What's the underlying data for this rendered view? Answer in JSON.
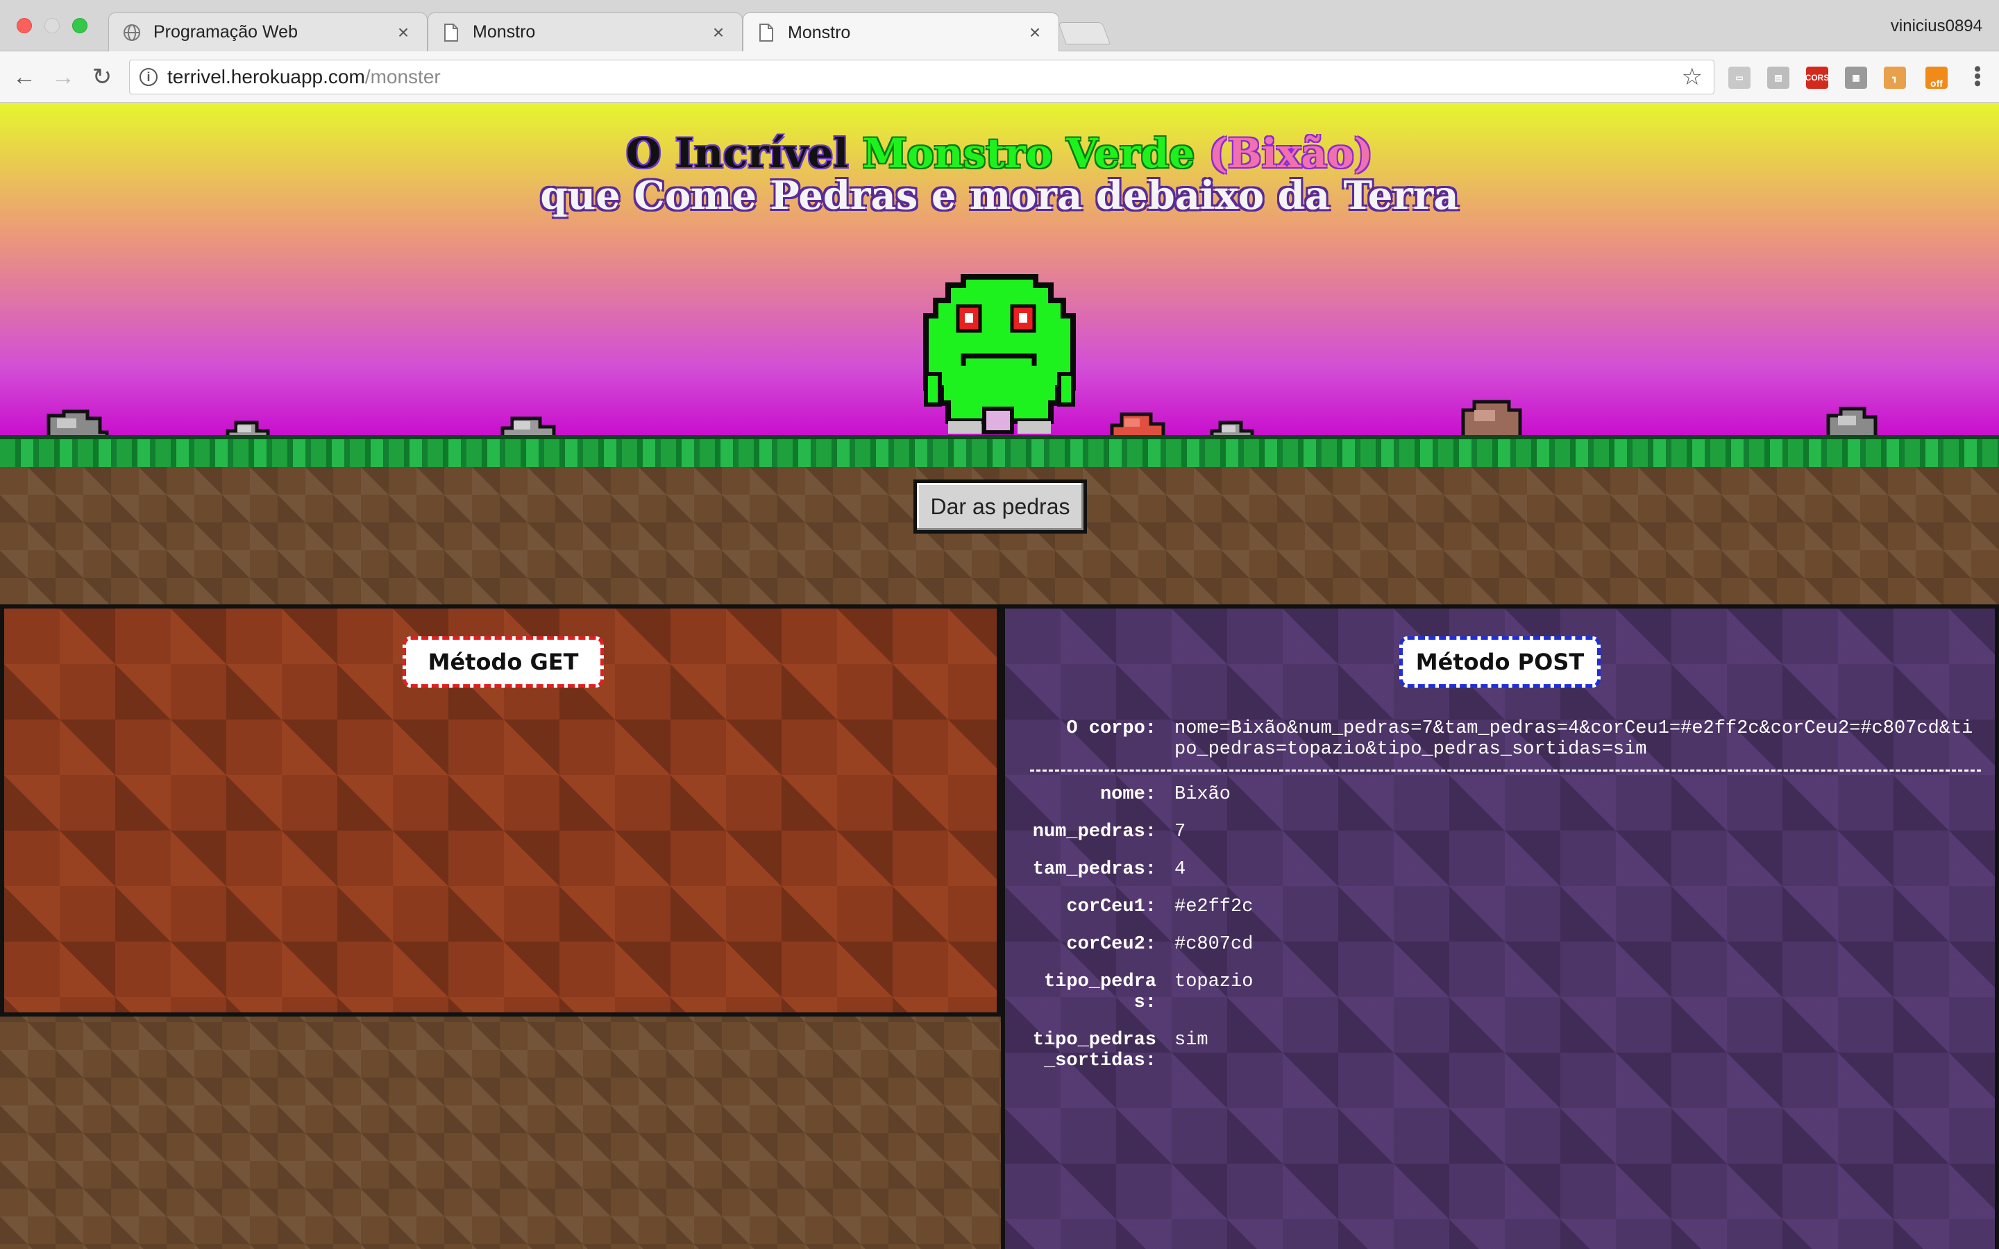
{
  "browser": {
    "tabs": [
      {
        "title": "Programação Web",
        "icon": "globe-icon"
      },
      {
        "title": "Monstro",
        "icon": "page-icon"
      },
      {
        "title": "Monstro",
        "icon": "page-icon"
      }
    ],
    "profile": "vinicius0894",
    "url_host": "terrivel.herokuapp.com",
    "url_path": "/monster",
    "extensions": [
      "cast-icon",
      "screenshot-icon",
      "cors-icon",
      "grid-icon",
      "hammer-icon",
      "off-icon"
    ],
    "cors_label": "CORS",
    "off_label": "off"
  },
  "page": {
    "title_part1": "O Incrível ",
    "title_part2": "Monstro Verde",
    "title_part3": " (Bixão)",
    "subtitle": "que Come Pedras e mora debaixo da Terra",
    "give_button": "Dar as pedras",
    "get_badge": "Método GET",
    "post_badge": "Método POST",
    "sky_top_color": "#e2ff2c",
    "sky_bottom_color": "#c807cd",
    "monster_color": "#1ef21e",
    "rock_count": 7,
    "post": {
      "body_label": "O corpo:",
      "body_value": "nome=Bixão&num_pedras=7&tam_pedras=4&corCeu1=#e2ff2c&corCeu2=#c807cd&tipo_pedras=topazio&tipo_pedras_sortidas=sim",
      "fields": [
        {
          "key": "nome:",
          "value": "Bixão"
        },
        {
          "key": "num_pedras:",
          "value": "7"
        },
        {
          "key": "tam_pedras:",
          "value": "4"
        },
        {
          "key": "corCeu1:",
          "value": "#e2ff2c"
        },
        {
          "key": "corCeu2:",
          "value": "#c807cd"
        },
        {
          "key": "tipo_pedras:",
          "value": "topazio"
        },
        {
          "key": "tipo_pedras_sortidas:",
          "value": "sim"
        }
      ]
    }
  }
}
